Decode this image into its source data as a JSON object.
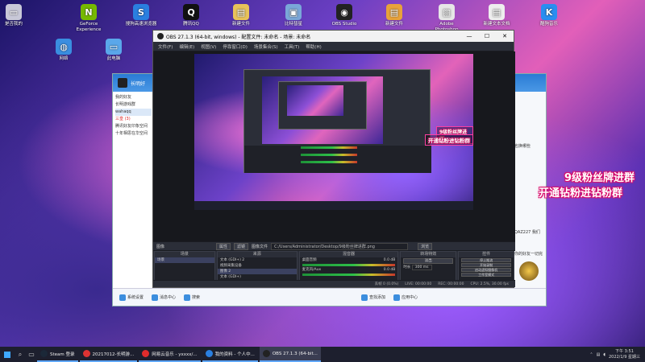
{
  "desktop": {
    "icons": [
      {
        "label": "是否我的",
        "color": "#c8c8d8",
        "glyph": "▭"
      },
      {
        "label": "GeForce Experience",
        "color": "#76b900",
        "glyph": "N"
      },
      {
        "label": "搜狗高速浏览器",
        "color": "#2a7fe0",
        "glyph": "S"
      },
      {
        "label": "腾讯QQ",
        "color": "#111",
        "glyph": "Q"
      },
      {
        "label": "新建文件",
        "color": "#e8c25a",
        "glyph": "▤"
      },
      {
        "label": "比特彗星",
        "color": "#7aa7d8",
        "glyph": "▣"
      },
      {
        "label": "OBS Studio",
        "color": "#222",
        "glyph": "◉"
      },
      {
        "label": "新建文件",
        "color": "#e8a23a",
        "glyph": "▤"
      },
      {
        "label": "Adobe Photoshop",
        "color": "#e6e6e6",
        "glyph": "▧"
      },
      {
        "label": "新建文本文档",
        "color": "#eee",
        "glyph": "▤"
      },
      {
        "label": "酷狗音乐",
        "color": "#2a8ef0",
        "glyph": "K"
      },
      {
        "label": "网络",
        "color": "#3a8ee0",
        "glyph": "◍"
      },
      {
        "label": "此电脑",
        "color": "#5aa7ea",
        "glyph": "▭"
      }
    ]
  },
  "qq": {
    "username": "长明好",
    "list_items": [
      "我的好友",
      "长明游戏群",
      "wahaqq",
      "三皇 (3)",
      "腾讯好友印象空间",
      "十年相思在华空间"
    ],
    "side_text_1": "也换哪些",
    "side_text_2": "QAZ227 我们",
    "side_text_3": "你的好友一切完",
    "bottom_buttons": [
      "系统设置",
      "消息中心",
      "搜索",
      "查找添加",
      "应用中心"
    ]
  },
  "obs": {
    "title": "OBS 27.1.3 (64-bit, windows) - 配置文件: 未命名 - 场景: 未命名",
    "win_buttons": [
      "—",
      "☐",
      "✕"
    ],
    "menu": [
      "文件(F)",
      "编辑(E)",
      "视图(V)",
      "停靠窗口(D)",
      "场景集合(S)",
      "工具(T)",
      "帮助(H)"
    ],
    "scenebar": {
      "label": "图像",
      "props": "属性",
      "filters": "滤镜",
      "file_label": "图像文件",
      "path": "C:/Users/Administrator/Desktop/9级粉丝牌进群.png",
      "browse": "浏览"
    },
    "scenes": {
      "header": "场景",
      "items": [
        "场景"
      ]
    },
    "sources": {
      "header": "来源",
      "items": [
        "文本 (GDI+) 2",
        "视频采集设备",
        "图像 2",
        "文本 (GDI+)",
        "图像",
        "显示器采集"
      ]
    },
    "mixer": {
      "header": "混音器",
      "track1": "桌面音频",
      "db1": "0.0 dB",
      "track2": "麦克风/Aux",
      "db2": "0.0 dB"
    },
    "transitions": {
      "header": "转场特效",
      "type": "淡出",
      "duration_label": "时长",
      "duration": "300 ms"
    },
    "controls": {
      "header": "控件",
      "buttons": [
        "停止推流",
        "开始录制",
        "启动虚拟摄像机",
        "工作室模式",
        "设置",
        "退出"
      ]
    },
    "status": [
      "丢帧 0 (0.0%)",
      "LIVE: 00:00:00",
      "REC: 00:00:00",
      "CPU: 2.5%, 30.00 fps"
    ],
    "nested_promo_1": "9级粉丝牌进群",
    "nested_promo_2": "开通钻粉进钻粉群"
  },
  "overlay": {
    "promo_1": "9级粉丝牌进群",
    "promo_2": "开通钻粉进钻粉群"
  },
  "taskbar": {
    "apps": [
      {
        "label": "Steam 登录",
        "color": "#1b2838"
      },
      {
        "label": "20217012-长明游...",
        "color": "#d33"
      },
      {
        "label": "网易云音乐 - yxxxx/...",
        "color": "#e02c2c"
      },
      {
        "label": "我的资料 - 个人中...",
        "color": "#2a7fe0"
      },
      {
        "label": "OBS 27.1.3 (64-bit...",
        "color": "#222"
      }
    ],
    "time": "下午 3:51",
    "date": "2022/1/9 星期三"
  }
}
